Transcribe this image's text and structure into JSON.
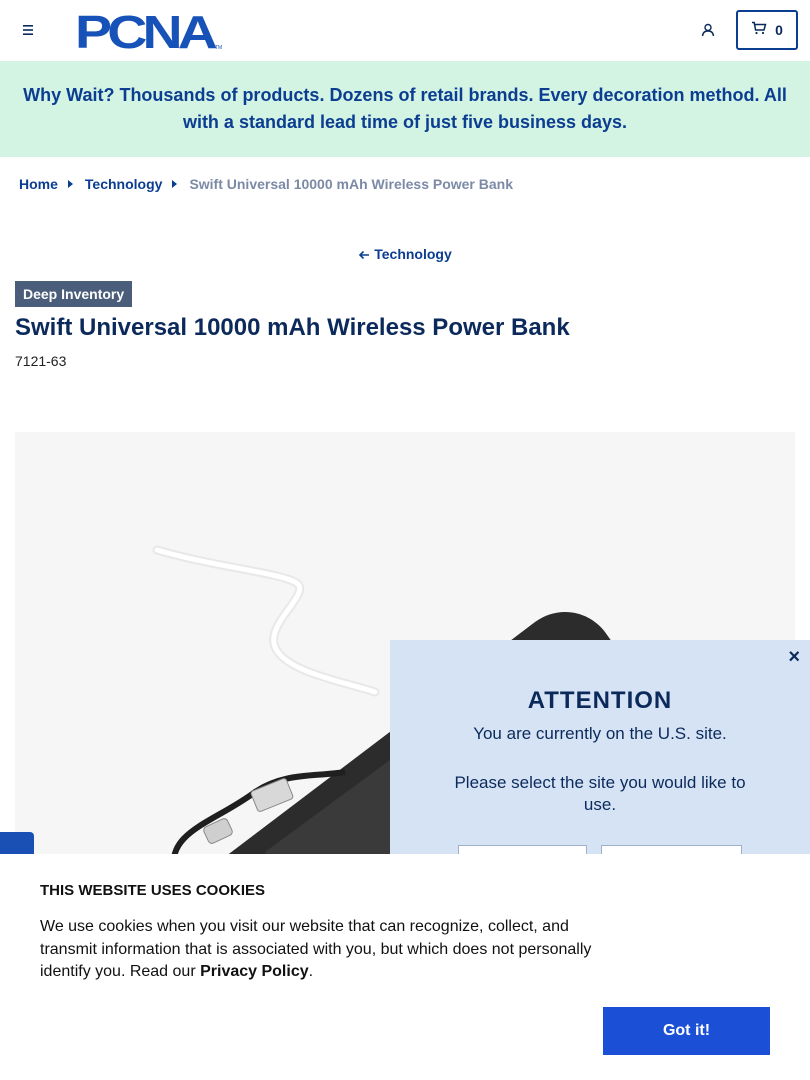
{
  "header": {
    "logo_text": "PCNA",
    "logo_tm": "TM",
    "cart_count": "0"
  },
  "banner": {
    "text": "Why Wait? Thousands of products. Dozens of retail brands. Every decoration method. All with a standard lead time of just five business days."
  },
  "breadcrumb": {
    "items": [
      "Home",
      "Technology"
    ],
    "current": "Swift Universal 10000 mAh Wireless Power Bank"
  },
  "product": {
    "back_label": "Technology",
    "badge": "Deep Inventory",
    "title": "Swift Universal 10000 mAh Wireless Power Bank",
    "sku": "7121-63"
  },
  "modal": {
    "close": "×",
    "title": "ATTENTION",
    "line1": "You are currently on the U.S. site.",
    "line2": "Please select the site you would like to use."
  },
  "cookie": {
    "title": "THIS WEBSITE USES COOKIES",
    "text_before": "We use cookies when you visit our website that can recognize, collect, and transmit information that is associated with you, but which does not personally identify you. Read our ",
    "link": "Privacy Policy",
    "text_after": ".",
    "button": "Got it!"
  },
  "colors": {
    "navy": "#0b2a5b",
    "brand_blue": "#0b3d91",
    "banner_bg": "#d3f3e3",
    "modal_bg": "#d6e3f5",
    "cta_blue": "#1a4fd6",
    "badge_bg": "#4a5e7c"
  }
}
